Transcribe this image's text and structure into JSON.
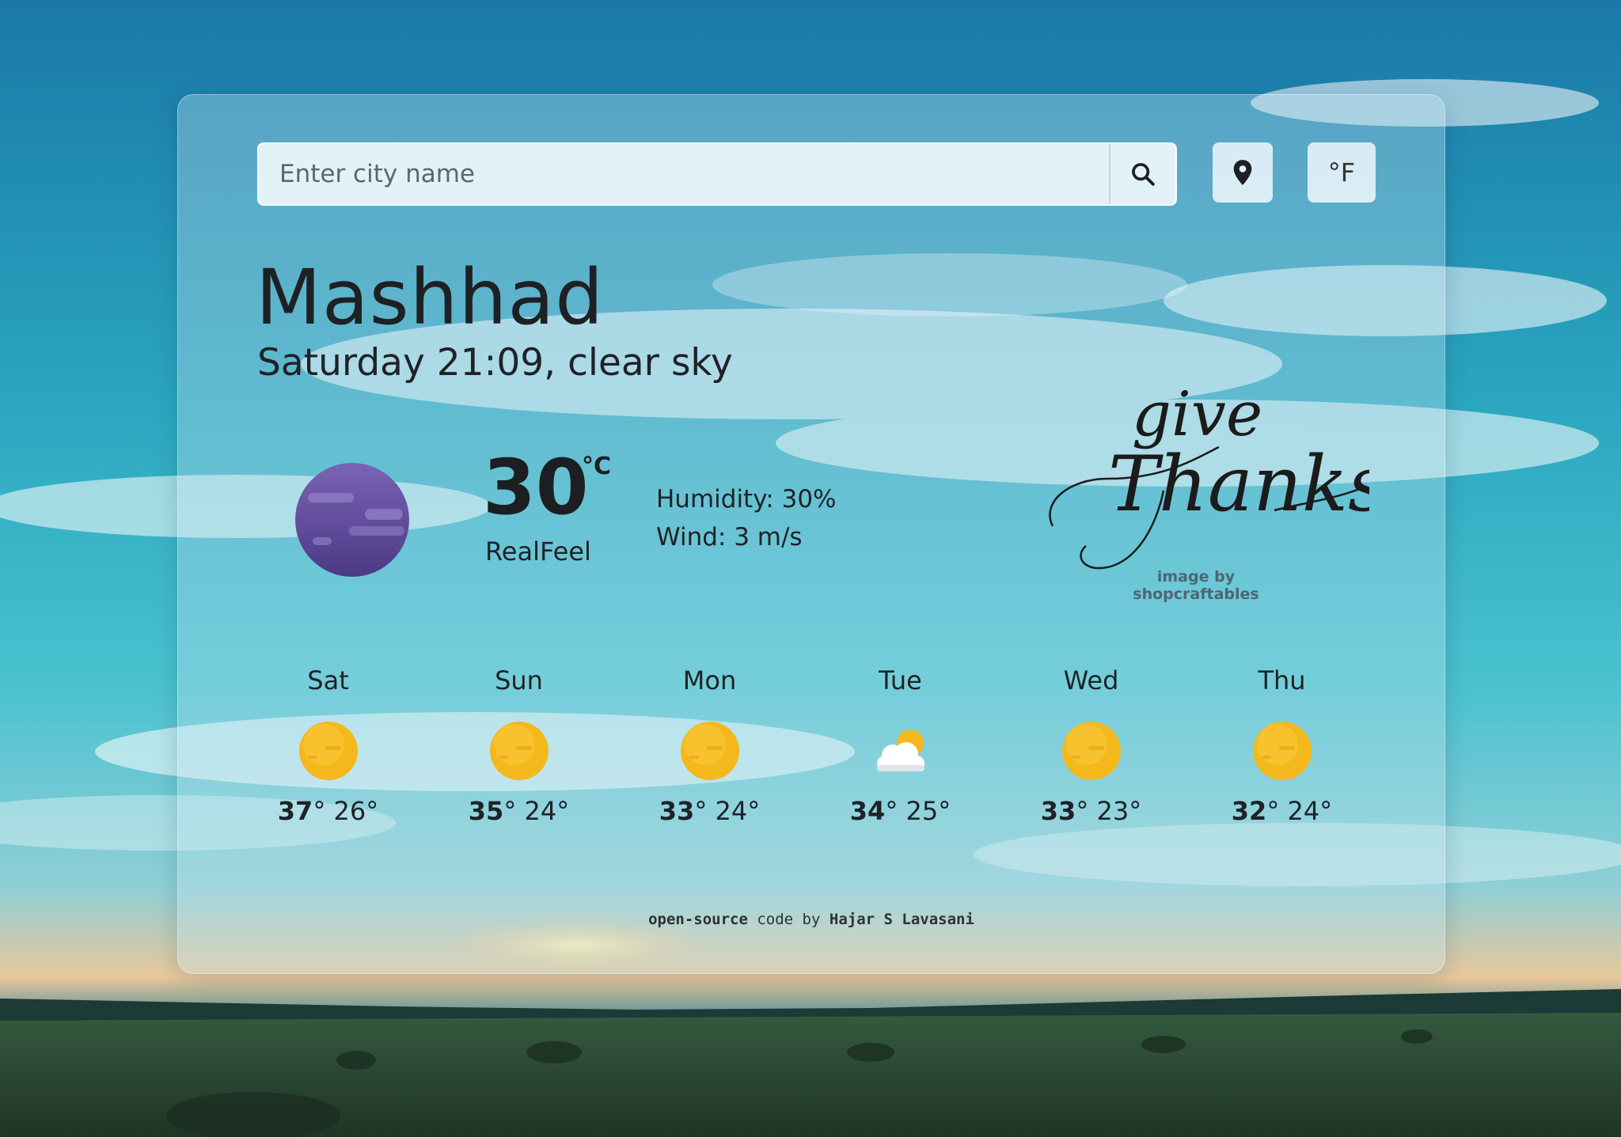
{
  "search": {
    "placeholder": "Enter city name",
    "search_icon": "search-icon",
    "location_icon": "map-pin-icon",
    "unit_toggle_label": "°F"
  },
  "current": {
    "city": "Mashhad",
    "subtitle": "Saturday 21:09, clear sky",
    "icon": "moon-night-icon",
    "temperature": "30",
    "temperature_unit": "°C",
    "realfeel_label": "RealFeel",
    "humidity": "Humidity: 30%",
    "wind": "Wind: 3 m/s"
  },
  "artwork": {
    "script_line1": "give",
    "script_line2": "Thanks",
    "credit": "image by shopcraftables"
  },
  "forecast": [
    {
      "day": "Sat",
      "icon": "sun-icon",
      "high": "37",
      "low": "26°"
    },
    {
      "day": "Sun",
      "icon": "sun-icon",
      "high": "35",
      "low": "24°"
    },
    {
      "day": "Mon",
      "icon": "sun-icon",
      "high": "33",
      "low": "24°"
    },
    {
      "day": "Tue",
      "icon": "partly-cloudy-icon",
      "high": "34",
      "low": "25°"
    },
    {
      "day": "Wed",
      "icon": "sun-icon",
      "high": "33",
      "low": "23°"
    },
    {
      "day": "Thu",
      "icon": "sun-icon",
      "high": "32",
      "low": "24°"
    }
  ],
  "footer": {
    "prefix": "open-source",
    "middle": " code by ",
    "author": "Hajar S Lavasani"
  },
  "colors": {
    "sky_top": "#1e7fae",
    "sky_mid": "#3fb6c8",
    "card_tint": "#c8e4f0",
    "moon": "#5d4a9a",
    "sun": "#f4b81c"
  }
}
